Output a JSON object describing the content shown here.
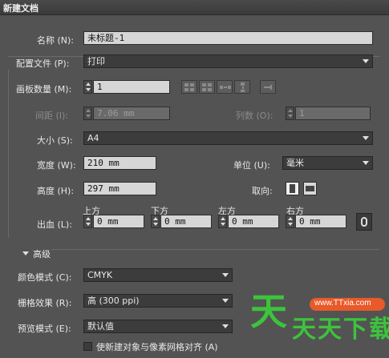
{
  "window": {
    "title": "新建文档"
  },
  "name": {
    "label": "名称 (N):",
    "value": "未标题-1"
  },
  "profile": {
    "label": "配置文件 (P):",
    "value": "打印"
  },
  "artboards": {
    "label": "画板数量 (M):",
    "value": "1"
  },
  "spacing": {
    "label": "间距 (I):",
    "value": "7.06 mm"
  },
  "columns": {
    "label": "列数 (O):",
    "value": "1"
  },
  "size": {
    "label": "大小 (S):",
    "value": "A4"
  },
  "width": {
    "label": "宽度 (W):",
    "value": "210 mm"
  },
  "units": {
    "label": "单位 (U):",
    "value": "毫米"
  },
  "height": {
    "label": "高度 (H):",
    "value": "297 mm"
  },
  "orientation": {
    "label": "取向:"
  },
  "bleed": {
    "label": "出血 (L):",
    "top_label": "上方",
    "top_value": "0 mm",
    "bottom_label": "下方",
    "bottom_value": "0 mm",
    "left_label": "左方",
    "left_value": "0 mm",
    "right_label": "右方",
    "right_value": "0 mm"
  },
  "advanced": {
    "label": "高级"
  },
  "color_mode": {
    "label": "颜色模式 (C):",
    "value": "CMYK"
  },
  "raster": {
    "label": "栅格效果 (R):",
    "value": "高 (300 ppi)"
  },
  "preview": {
    "label": "预览模式 (E):",
    "value": "默认值"
  },
  "align_pixel": {
    "label": "使新建对象与像素网格对齐 (A)"
  },
  "watermark": {
    "big": "天天下载",
    "url": "www.TTxia.com"
  },
  "colors": {
    "panel": "#535353",
    "field": "#d6d6d6",
    "dropdown": "#3c3c3c",
    "watermark": "#3cc43c",
    "badge": "#e85a2a"
  }
}
